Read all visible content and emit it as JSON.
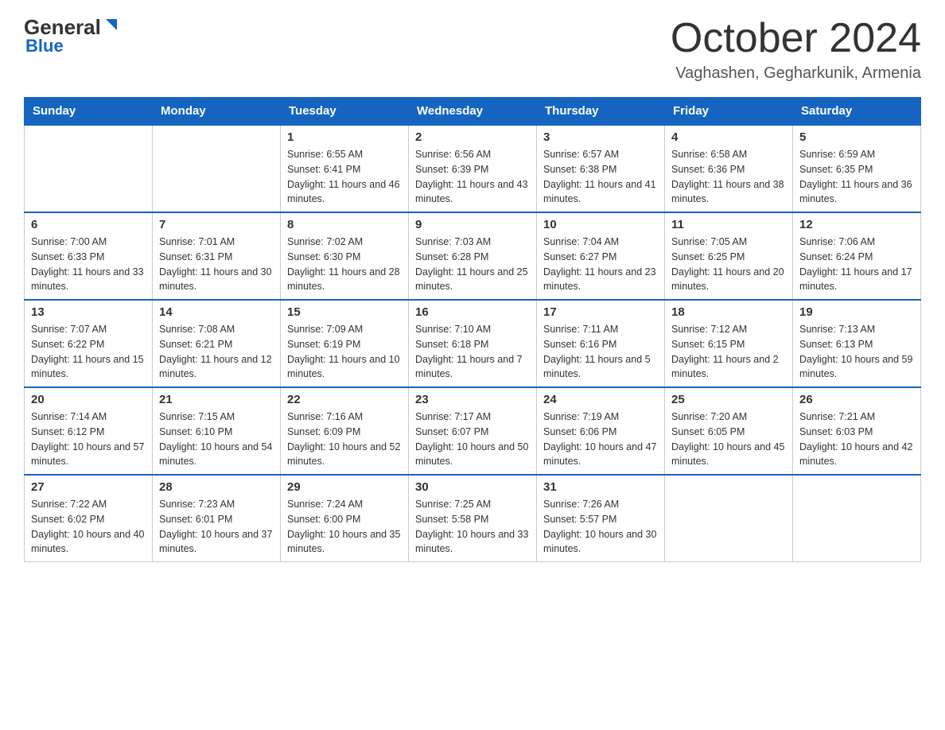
{
  "header": {
    "logo_general": "General",
    "logo_blue": "Blue",
    "title": "October 2024",
    "location": "Vaghashen, Gegharkunik, Armenia"
  },
  "weekdays": [
    "Sunday",
    "Monday",
    "Tuesday",
    "Wednesday",
    "Thursday",
    "Friday",
    "Saturday"
  ],
  "weeks": [
    [
      {
        "day": "",
        "info": ""
      },
      {
        "day": "",
        "info": ""
      },
      {
        "day": "1",
        "sunrise": "Sunrise: 6:55 AM",
        "sunset": "Sunset: 6:41 PM",
        "daylight": "Daylight: 11 hours and 46 minutes."
      },
      {
        "day": "2",
        "sunrise": "Sunrise: 6:56 AM",
        "sunset": "Sunset: 6:39 PM",
        "daylight": "Daylight: 11 hours and 43 minutes."
      },
      {
        "day": "3",
        "sunrise": "Sunrise: 6:57 AM",
        "sunset": "Sunset: 6:38 PM",
        "daylight": "Daylight: 11 hours and 41 minutes."
      },
      {
        "day": "4",
        "sunrise": "Sunrise: 6:58 AM",
        "sunset": "Sunset: 6:36 PM",
        "daylight": "Daylight: 11 hours and 38 minutes."
      },
      {
        "day": "5",
        "sunrise": "Sunrise: 6:59 AM",
        "sunset": "Sunset: 6:35 PM",
        "daylight": "Daylight: 11 hours and 36 minutes."
      }
    ],
    [
      {
        "day": "6",
        "sunrise": "Sunrise: 7:00 AM",
        "sunset": "Sunset: 6:33 PM",
        "daylight": "Daylight: 11 hours and 33 minutes."
      },
      {
        "day": "7",
        "sunrise": "Sunrise: 7:01 AM",
        "sunset": "Sunset: 6:31 PM",
        "daylight": "Daylight: 11 hours and 30 minutes."
      },
      {
        "day": "8",
        "sunrise": "Sunrise: 7:02 AM",
        "sunset": "Sunset: 6:30 PM",
        "daylight": "Daylight: 11 hours and 28 minutes."
      },
      {
        "day": "9",
        "sunrise": "Sunrise: 7:03 AM",
        "sunset": "Sunset: 6:28 PM",
        "daylight": "Daylight: 11 hours and 25 minutes."
      },
      {
        "day": "10",
        "sunrise": "Sunrise: 7:04 AM",
        "sunset": "Sunset: 6:27 PM",
        "daylight": "Daylight: 11 hours and 23 minutes."
      },
      {
        "day": "11",
        "sunrise": "Sunrise: 7:05 AM",
        "sunset": "Sunset: 6:25 PM",
        "daylight": "Daylight: 11 hours and 20 minutes."
      },
      {
        "day": "12",
        "sunrise": "Sunrise: 7:06 AM",
        "sunset": "Sunset: 6:24 PM",
        "daylight": "Daylight: 11 hours and 17 minutes."
      }
    ],
    [
      {
        "day": "13",
        "sunrise": "Sunrise: 7:07 AM",
        "sunset": "Sunset: 6:22 PM",
        "daylight": "Daylight: 11 hours and 15 minutes."
      },
      {
        "day": "14",
        "sunrise": "Sunrise: 7:08 AM",
        "sunset": "Sunset: 6:21 PM",
        "daylight": "Daylight: 11 hours and 12 minutes."
      },
      {
        "day": "15",
        "sunrise": "Sunrise: 7:09 AM",
        "sunset": "Sunset: 6:19 PM",
        "daylight": "Daylight: 11 hours and 10 minutes."
      },
      {
        "day": "16",
        "sunrise": "Sunrise: 7:10 AM",
        "sunset": "Sunset: 6:18 PM",
        "daylight": "Daylight: 11 hours and 7 minutes."
      },
      {
        "day": "17",
        "sunrise": "Sunrise: 7:11 AM",
        "sunset": "Sunset: 6:16 PM",
        "daylight": "Daylight: 11 hours and 5 minutes."
      },
      {
        "day": "18",
        "sunrise": "Sunrise: 7:12 AM",
        "sunset": "Sunset: 6:15 PM",
        "daylight": "Daylight: 11 hours and 2 minutes."
      },
      {
        "day": "19",
        "sunrise": "Sunrise: 7:13 AM",
        "sunset": "Sunset: 6:13 PM",
        "daylight": "Daylight: 10 hours and 59 minutes."
      }
    ],
    [
      {
        "day": "20",
        "sunrise": "Sunrise: 7:14 AM",
        "sunset": "Sunset: 6:12 PM",
        "daylight": "Daylight: 10 hours and 57 minutes."
      },
      {
        "day": "21",
        "sunrise": "Sunrise: 7:15 AM",
        "sunset": "Sunset: 6:10 PM",
        "daylight": "Daylight: 10 hours and 54 minutes."
      },
      {
        "day": "22",
        "sunrise": "Sunrise: 7:16 AM",
        "sunset": "Sunset: 6:09 PM",
        "daylight": "Daylight: 10 hours and 52 minutes."
      },
      {
        "day": "23",
        "sunrise": "Sunrise: 7:17 AM",
        "sunset": "Sunset: 6:07 PM",
        "daylight": "Daylight: 10 hours and 50 minutes."
      },
      {
        "day": "24",
        "sunrise": "Sunrise: 7:19 AM",
        "sunset": "Sunset: 6:06 PM",
        "daylight": "Daylight: 10 hours and 47 minutes."
      },
      {
        "day": "25",
        "sunrise": "Sunrise: 7:20 AM",
        "sunset": "Sunset: 6:05 PM",
        "daylight": "Daylight: 10 hours and 45 minutes."
      },
      {
        "day": "26",
        "sunrise": "Sunrise: 7:21 AM",
        "sunset": "Sunset: 6:03 PM",
        "daylight": "Daylight: 10 hours and 42 minutes."
      }
    ],
    [
      {
        "day": "27",
        "sunrise": "Sunrise: 7:22 AM",
        "sunset": "Sunset: 6:02 PM",
        "daylight": "Daylight: 10 hours and 40 minutes."
      },
      {
        "day": "28",
        "sunrise": "Sunrise: 7:23 AM",
        "sunset": "Sunset: 6:01 PM",
        "daylight": "Daylight: 10 hours and 37 minutes."
      },
      {
        "day": "29",
        "sunrise": "Sunrise: 7:24 AM",
        "sunset": "Sunset: 6:00 PM",
        "daylight": "Daylight: 10 hours and 35 minutes."
      },
      {
        "day": "30",
        "sunrise": "Sunrise: 7:25 AM",
        "sunset": "Sunset: 5:58 PM",
        "daylight": "Daylight: 10 hours and 33 minutes."
      },
      {
        "day": "31",
        "sunrise": "Sunrise: 7:26 AM",
        "sunset": "Sunset: 5:57 PM",
        "daylight": "Daylight: 10 hours and 30 minutes."
      },
      {
        "day": "",
        "info": ""
      },
      {
        "day": "",
        "info": ""
      }
    ]
  ]
}
